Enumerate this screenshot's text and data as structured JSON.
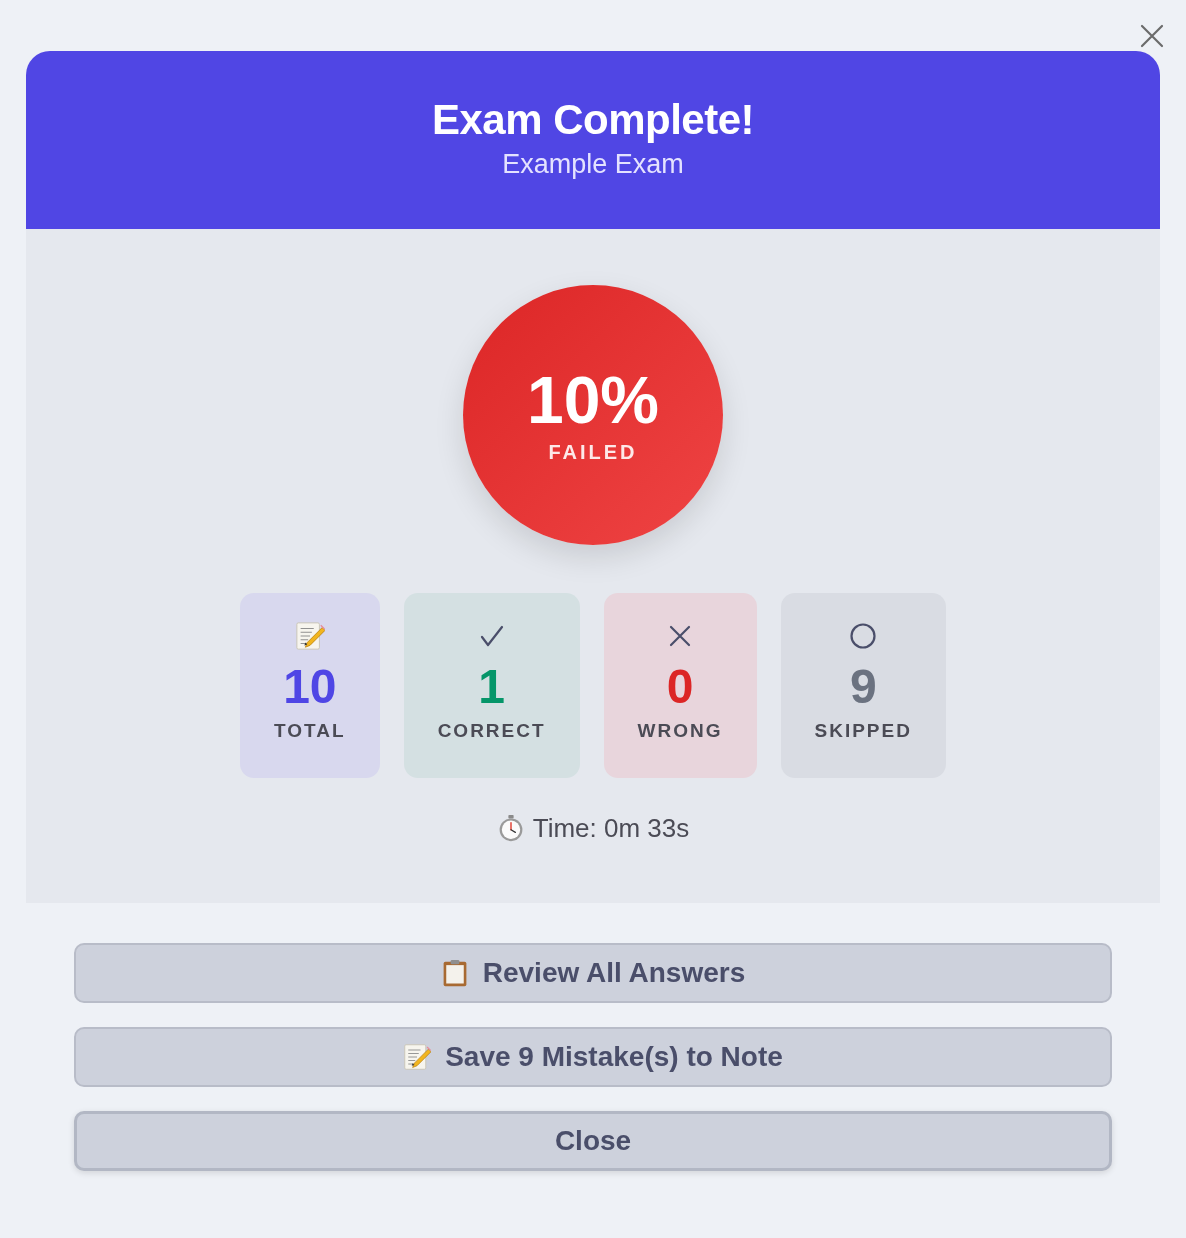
{
  "header": {
    "title": "Exam Complete!",
    "subtitle": "Example Exam"
  },
  "score": {
    "percent": "10%",
    "verdict": "FAILED",
    "passed": false
  },
  "stats": [
    {
      "kind": "total",
      "value": "10",
      "label": "TOTAL"
    },
    {
      "kind": "correct",
      "value": "1",
      "label": "CORRECT"
    },
    {
      "kind": "wrong",
      "value": "0",
      "label": "WRONG"
    },
    {
      "kind": "skipped",
      "value": "9",
      "label": "SKIPPED"
    }
  ],
  "time": "Time: 0m 33s",
  "actions": [
    {
      "kind": "clipboard",
      "label": "Review All Answers",
      "focused": false
    },
    {
      "kind": "memo",
      "label": "Save 9 Mistake(s) to Note",
      "focused": false
    },
    {
      "kind": "plain",
      "label": "Close",
      "focused": true
    }
  ]
}
